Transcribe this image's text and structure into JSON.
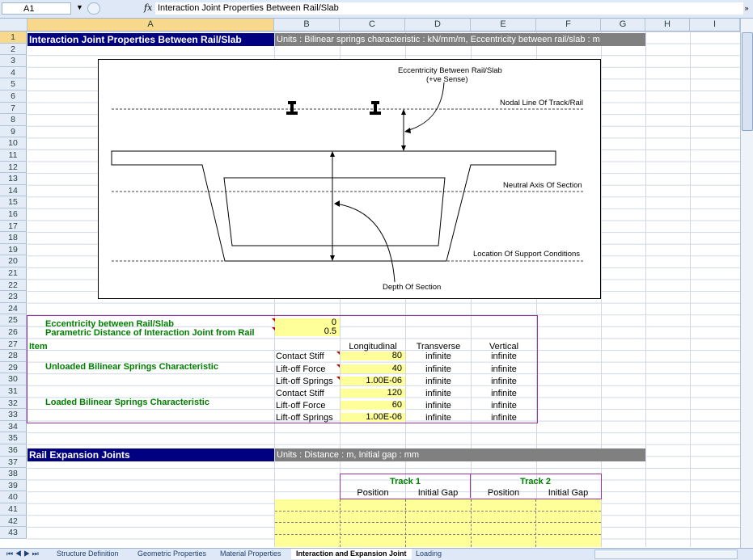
{
  "formula_bar": {
    "name_box": "A1",
    "fx": "fx",
    "formula": "Interaction Joint Properties Between Rail/Slab"
  },
  "columns": [
    "A",
    "B",
    "C",
    "D",
    "E",
    "F",
    "G",
    "H",
    "I"
  ],
  "rows": [
    "1",
    "2",
    "3",
    "4",
    "5",
    "6",
    "7",
    "8",
    "9",
    "10",
    "11",
    "12",
    "13",
    "14",
    "15",
    "16",
    "17",
    "18",
    "19",
    "20",
    "21",
    "22",
    "23",
    "24",
    "25",
    "26",
    "27",
    "28",
    "29",
    "30",
    "31",
    "32",
    "33",
    "34",
    "35",
    "36",
    "37",
    "38",
    "39",
    "40",
    "41",
    "42",
    "43"
  ],
  "section1": {
    "title": "Interaction Joint Properties Between Rail/Slab",
    "units": "Units : Bilinear springs characteristic : kN/mm/m, Eccentricity between rail/slab : m"
  },
  "figure": {
    "label_ecc": "Eccentricity Between Rail/Slab",
    "label_ecc_sense": "(+ve Sense)",
    "label_nodal": "Nodal Line Of Track/Rail",
    "label_neutral": "Neutral Axis Of Section",
    "label_support": "Location Of Support Conditions",
    "label_depth": "Depth Of Section"
  },
  "params": {
    "ecc_label": "Eccentricity between Rail/Slab",
    "ecc_value": "0",
    "dist_label": "Parametric Distance of Interaction Joint from Rail",
    "dist_value": "0.5"
  },
  "table": {
    "item_header": "Item",
    "headers": [
      "Longitudinal",
      "Transverse",
      "Vertical"
    ],
    "unloaded_label": "Unloaded Bilinear Springs Characteristic",
    "loaded_label": "Loaded Bilinear Springs    Characteristic",
    "unloaded": [
      {
        "prop": "Contact Stiff",
        "long": "80",
        "trans": "infinite",
        "vert": "infinite"
      },
      {
        "prop": "Lift-off Force",
        "long": "40",
        "trans": "infinite",
        "vert": "infinite"
      },
      {
        "prop": "Lift-off Springs",
        "long": "1.00E-06",
        "trans": "infinite",
        "vert": "infinite"
      }
    ],
    "loaded": [
      {
        "prop": "Contact Stiff",
        "long": "120",
        "trans": "infinite",
        "vert": "infinite"
      },
      {
        "prop": "Lift-off Force",
        "long": "60",
        "trans": "infinite",
        "vert": "infinite"
      },
      {
        "prop": "Lift-off Springs",
        "long": "1.00E-06",
        "trans": "infinite",
        "vert": "infinite"
      }
    ]
  },
  "section2": {
    "title": "Rail Expansion Joints",
    "units": "Units : Distance : m, Initial gap : mm",
    "track1": "Track 1",
    "track2": "Track 2",
    "position": "Position",
    "initial_gap": "Initial Gap"
  },
  "sheet_tabs": [
    "Structure Definition",
    "Geometric Properties",
    "Material Properties",
    "Interaction and Expansion Joint",
    "Loading"
  ],
  "active_tab": "Interaction and Expansion Joint",
  "colors": {
    "navy": "#000080",
    "green": "#008000",
    "yellow": "#ffff99",
    "header_bg": "#e4ecf7",
    "selected_header": "#f8d88c"
  }
}
